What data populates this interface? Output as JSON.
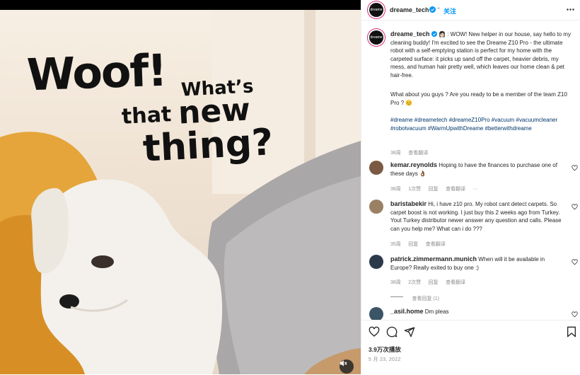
{
  "media": {
    "text_woof": "Woof!",
    "text_whats": "What’s",
    "text_that": "that",
    "text_new": "new",
    "text_thing": "thing?"
  },
  "header": {
    "avatar_text": "dreame",
    "username": "dreame_tech",
    "separator": "•",
    "follow_label": "关注",
    "more_icon": "more-horizontal-icon"
  },
  "caption": {
    "username": "dreame_tech",
    "emoji": "👩🏻",
    "body": ": WOW!  New helper in our house, say hello to my cleaning buddy! I'm excited to see the Dreame Z10 Pro - the ultimate robot with a self-emptying station is perfect for my home with the carpeted surface: it picks up sand off the carpet, heavier debris, my mess, and human hair pretty well, which leaves our home clean & pet hair-free.",
    "question": "What about you guys ? Are you ready to be a member of the team Z10 Pro ? 😊",
    "hashtags": "#dreame #dreametech #dreameZ10Pro #vacuum #vacuumcleaner #robotvacuum #WarmUpwithDreame #betterwithdreame",
    "time": "38周",
    "translate": "查看翻译"
  },
  "comments": [
    {
      "username": "kemar.reynolds",
      "text": "Hoping to have the finances to purchase one of these days 👌🏾",
      "time": "38周",
      "likes": "1次赞",
      "reply": "回复",
      "translate": "查看翻译",
      "more": "···"
    },
    {
      "username": "baristabekir",
      "text": "Hi, i have z10 pro. My robot cant detect carpets. So carpet boost is not working. I just buy this 2 weeks ago from Turkey. Yout Turkey distributor newer answer any question and calls. Please can you help me? What can i do ???",
      "time": "35周",
      "reply": "回复",
      "translate": "查看翻译"
    },
    {
      "username": "patrick.zimmermann.munich",
      "text": "When will it be available in Europe? Really exited to buy one :)",
      "time": "38周",
      "likes": "2次赞",
      "reply": "回复",
      "translate": "查看翻译",
      "view_replies": "查看回复 (1)"
    },
    {
      "username": "_asil.home",
      "text": "Dm pleas"
    }
  ],
  "footer": {
    "views": "3.9万次播放",
    "date": "5 月 23, 2022",
    "icons": [
      "heart-icon",
      "comment-icon",
      "share-icon",
      "bookmark-icon"
    ]
  },
  "colors": {
    "accent_blue": "#0095f6",
    "hashtag_blue": "#00376b",
    "muted_gray": "#8e8e8e"
  }
}
